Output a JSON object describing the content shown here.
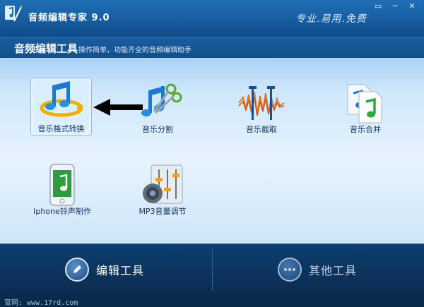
{
  "window": {
    "title": "音频编辑专家 9.0",
    "slogan": "专业.易用.免费",
    "controls": [
      "▭",
      "─",
      "✕"
    ]
  },
  "subheader": {
    "title": "音频编辑工具",
    "description": "操作简单，功能齐全的音频编辑助手"
  },
  "tools": [
    {
      "label": "音乐格式转换",
      "icon": "music-convert-icon",
      "selected": true
    },
    {
      "label": "音乐分割",
      "icon": "music-split-icon",
      "selected": false
    },
    {
      "label": "音乐截取",
      "icon": "music-trim-icon",
      "selected": false
    },
    {
      "label": "音乐合并",
      "icon": "music-merge-icon",
      "selected": false
    },
    {
      "label": "Iphone铃声制作",
      "icon": "iphone-ringtone-icon",
      "selected": false
    },
    {
      "label": "MP3音量调节",
      "icon": "mp3-volume-icon",
      "selected": false
    }
  ],
  "bottom": {
    "edit_tools": "编辑工具",
    "other_tools": "其他工具"
  },
  "status": {
    "site": "官网: www.17rd.com"
  },
  "colors": {
    "accent_blue": "#1f6fb6",
    "dark_navy": "#0b3f72",
    "note_blue": "#2a8ee0",
    "gold_arrow": "#f4b400"
  }
}
